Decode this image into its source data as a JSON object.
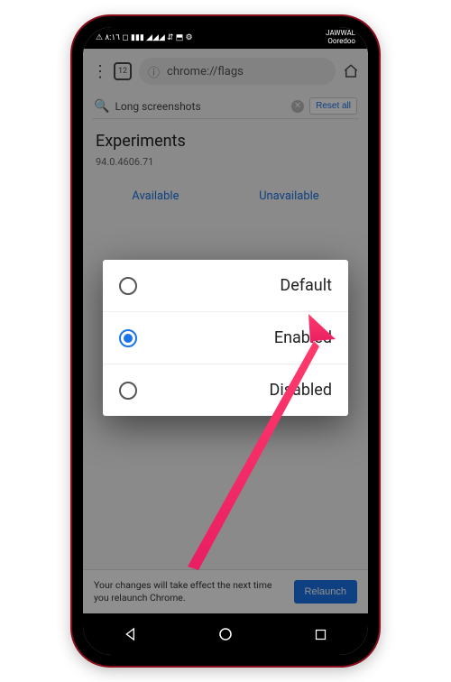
{
  "status": {
    "left": "⚠ ٨:١٦ ◻ ▮▮▮ ◢◢◢ ⇵ ⬒ ⚙",
    "right_top": "JAWWAL",
    "right_bottom": "Ooredoo"
  },
  "browser": {
    "tab_count": "12",
    "url_scheme": "ⓘ",
    "url_text": "chrome://flags"
  },
  "search": {
    "query": "Long screenshots",
    "reset": "Reset all"
  },
  "page": {
    "title": "Experiments",
    "version": "94.0.4606.71",
    "tabs": [
      "Available",
      "Unavailable"
    ]
  },
  "modal_options": [
    {
      "label": "Default",
      "selected": false
    },
    {
      "label": "Enabled",
      "selected": true
    },
    {
      "label": "Disabled",
      "selected": false
    }
  ],
  "bottom": {
    "message": "Your changes will take effect the next time you relaunch Chrome.",
    "button": "Relaunch"
  },
  "colors": {
    "accent": "#1a73e8",
    "arrow": "#e91e63"
  }
}
